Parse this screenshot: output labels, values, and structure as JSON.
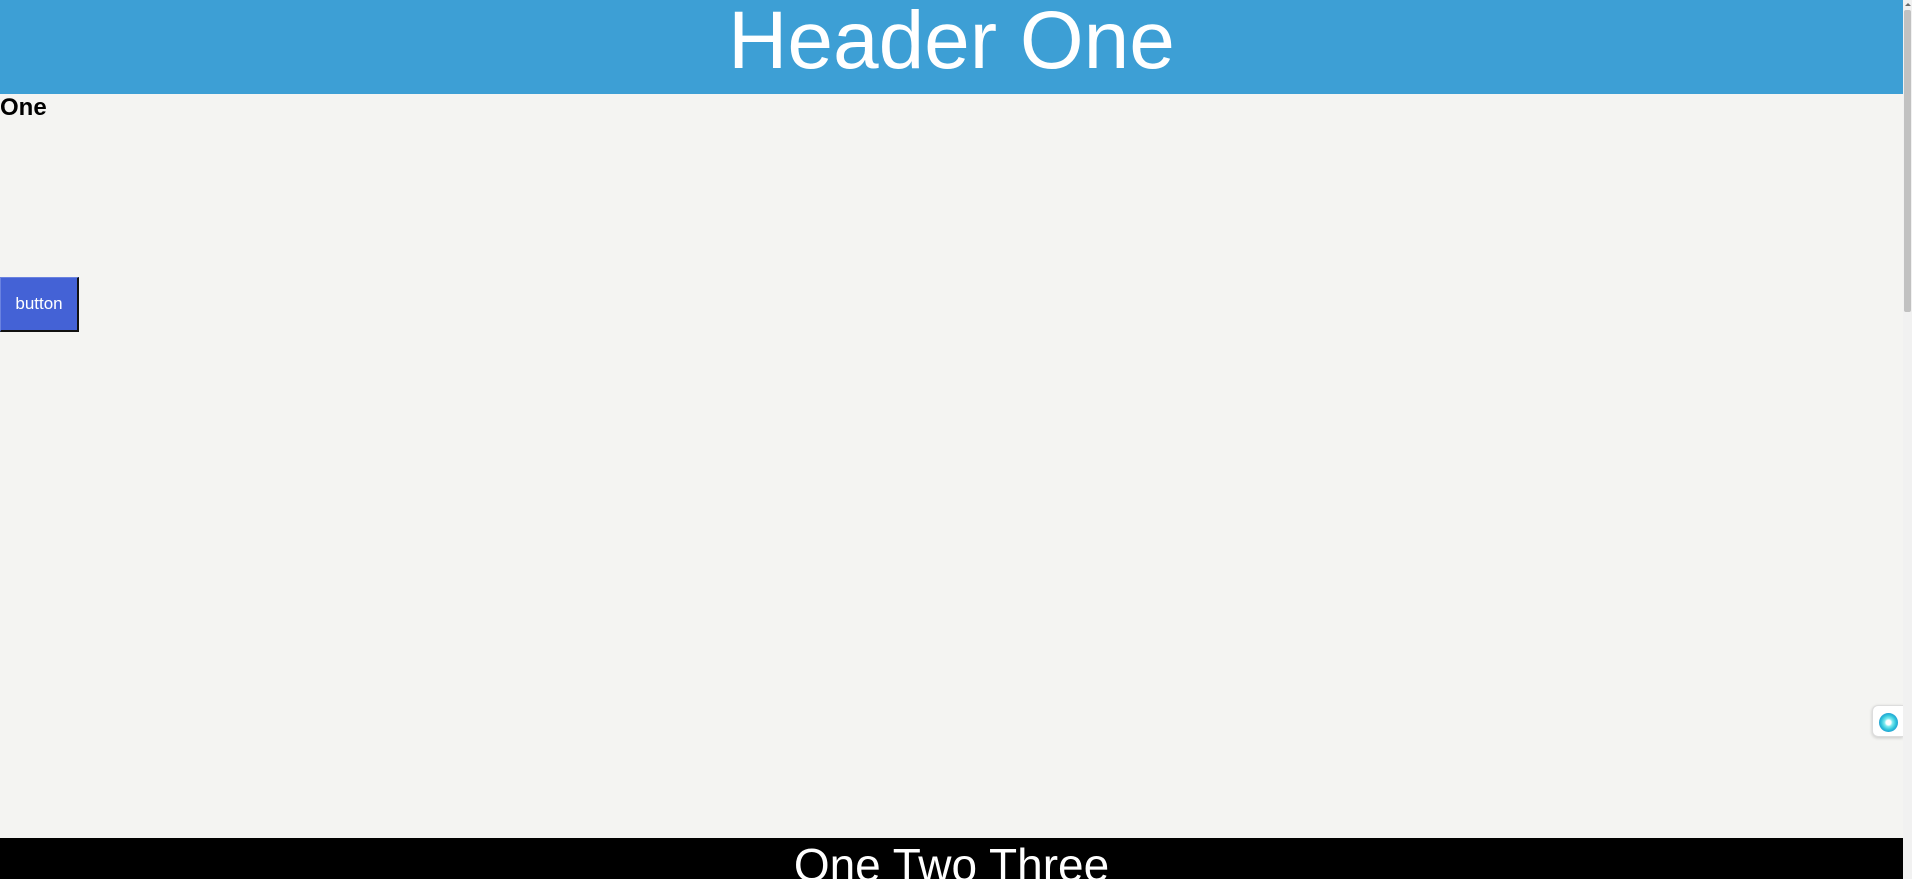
{
  "header": {
    "title": "Header One",
    "background_color": "#3d9fd5"
  },
  "main": {
    "section_heading": "One",
    "button_label": "button",
    "button_color": "#4462d6"
  },
  "footer": {
    "text": "One Two Three",
    "background_color": "#000000"
  },
  "floating_widget": {
    "icon": "assistant-orb-icon"
  },
  "colors": {
    "page_background": "#f4f4f2"
  }
}
